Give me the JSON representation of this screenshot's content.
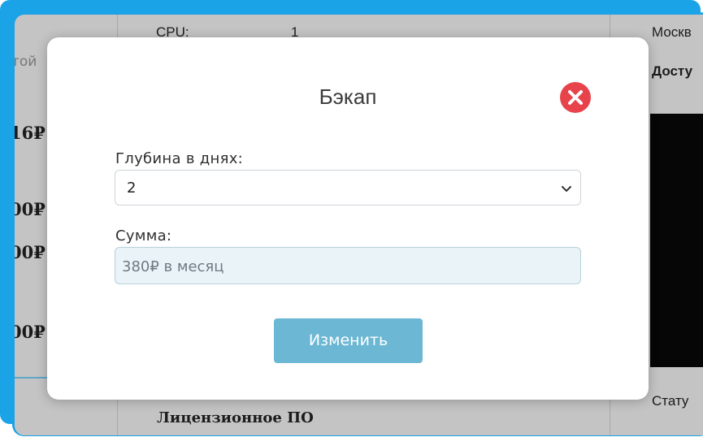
{
  "background": {
    "cpu_label": "CPU:",
    "cpu_value": "1",
    "left_fragment": "той",
    "price_1": "16₽",
    "price_2": "00₽",
    "price_3": "00₽",
    "price_4": "00₽",
    "location_fragment": "Москв",
    "access_fragment": "Досту",
    "status_fragment": "Стату",
    "license_label": "Лицензионное ПО"
  },
  "modal": {
    "title": "Бэкап",
    "close_icon": "close-x-icon",
    "depth_label": "Глубина в днях:",
    "depth_value": "2",
    "sum_label": "Сумма:",
    "sum_value": "380₽ в месяц",
    "submit_label": "Изменить"
  },
  "colors": {
    "frame": "#1aa3e6",
    "close": "#e8434b",
    "button": "#6cb7d3",
    "readonly_field": "#eaf4f8"
  }
}
